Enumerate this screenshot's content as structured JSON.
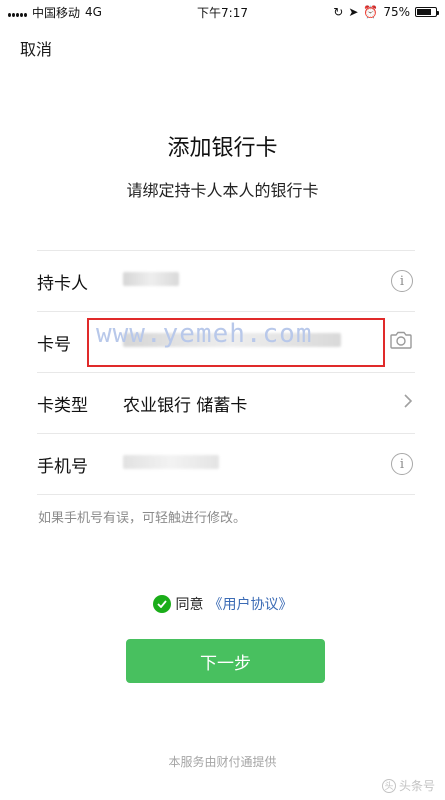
{
  "status_bar": {
    "carrier": "中国移动",
    "network": "4G",
    "time": "下午7:17",
    "battery": "75%",
    "battery_level": 0.75
  },
  "nav": {
    "cancel_label": "取消"
  },
  "header": {
    "title": "添加银行卡",
    "subtitle": "请绑定持卡人本人的银行卡"
  },
  "form": {
    "rows": [
      {
        "label": "持卡人",
        "value": "",
        "icon": "info-icon"
      },
      {
        "label": "卡号",
        "value": "",
        "icon": "camera-icon"
      },
      {
        "label": "卡类型",
        "value": "农业银行 储蓄卡",
        "icon": "chevron-right-icon"
      },
      {
        "label": "手机号",
        "value": "",
        "icon": "info-icon"
      }
    ],
    "hint": "如果手机号有误，可轻触进行修改。"
  },
  "watermark": "www.yemeh.com",
  "agreement": {
    "prefix": "同意",
    "link": "《用户协议》"
  },
  "buttons": {
    "next": "下一步"
  },
  "footer": "本服务由财付通提供",
  "corner_watermark": "头条号"
}
